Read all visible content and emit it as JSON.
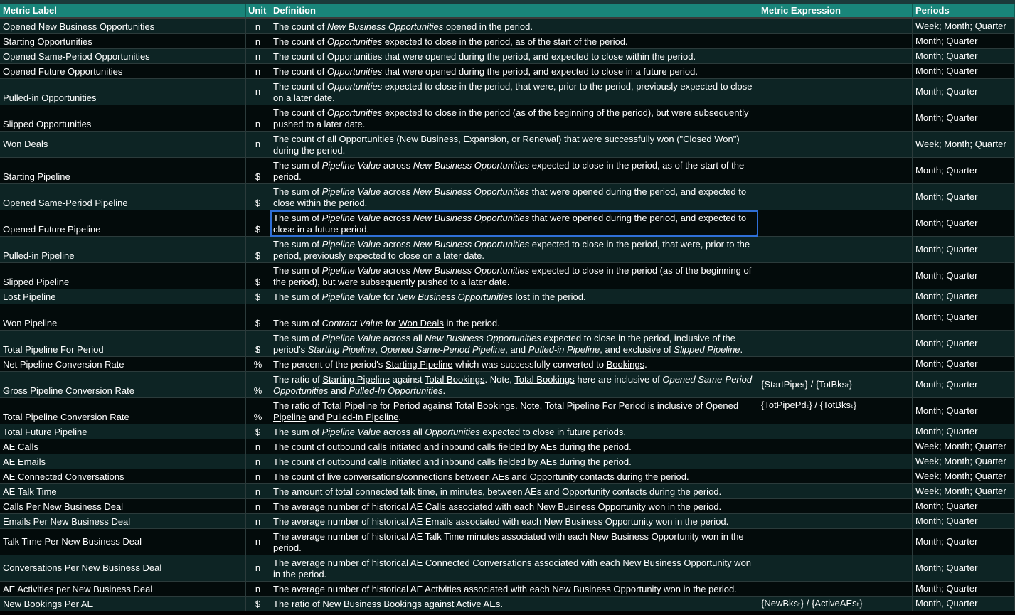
{
  "headers": {
    "label": "Metric Label",
    "unit": "Unit",
    "definition": "Definition",
    "expression": "Metric Expression",
    "periods": "Periods"
  },
  "rows": [
    {
      "label": "Opened New Business Opportunities",
      "unit": "n",
      "def": [
        {
          "t": "The count of "
        },
        {
          "t": "New Business Opportunities",
          "i": 1
        },
        {
          "t": " opened in the period."
        }
      ],
      "expr": "",
      "periods": "Week; Month; Quarter",
      "h": 1
    },
    {
      "label": "Starting Opportunities",
      "unit": "n",
      "def": [
        {
          "t": "The count of "
        },
        {
          "t": "Opportunities",
          "i": 1
        },
        {
          "t": " expected to close in the period, as of the start of the period."
        }
      ],
      "expr": "",
      "periods": "Month; Quarter",
      "h": 1
    },
    {
      "label": "Opened Same-Period Opportunities",
      "unit": "n",
      "def": [
        {
          "t": "The count of Opportunities that were opened during the period, and expected to close within the period."
        }
      ],
      "expr": "",
      "periods": "Month; Quarter",
      "h": 1
    },
    {
      "label": "Opened Future Opportunities",
      "unit": "n",
      "def": [
        {
          "t": "The count of "
        },
        {
          "t": "Opportunities",
          "i": 1
        },
        {
          "t": " that were opened during the period, and expected to close in a future period."
        }
      ],
      "expr": "",
      "periods": "Month; Quarter",
      "h": 1
    },
    {
      "label": "Pulled-in Opportunities",
      "unit": "n",
      "def": [
        {
          "t": "The count of "
        },
        {
          "t": "Opportunities",
          "i": 1
        },
        {
          "t": " expected to close in the period, that were, prior to the period, previously expected to close on a later date."
        }
      ],
      "expr": "",
      "periods": "Month; Quarter",
      "h": 2,
      "unitMid": 1
    },
    {
      "label": "Slipped Opportunities",
      "unit": "n",
      "def": [
        {
          "t": "The count of "
        },
        {
          "t": "Opportunities",
          "i": 1
        },
        {
          "t": " expected to close in the period (as of the beginning of the period), but were subsequently pushed to a later date."
        }
      ],
      "expr": "",
      "periods": "Month; Quarter",
      "h": 2
    },
    {
      "label": "Won Deals",
      "unit": "n",
      "def": [
        {
          "t": "The count of all Opportunities (New Business, Expansion, or Renewal) that were successfully won (\"Closed Won\") during the period."
        }
      ],
      "expr": "",
      "periods": "Week; Month; Quarter",
      "h": 2,
      "labelMid": 1,
      "unitMid": 1
    },
    {
      "label": "Starting Pipeline",
      "unit": "$",
      "def": [
        {
          "t": "The sum of "
        },
        {
          "t": "Pipeline Value",
          "i": 1
        },
        {
          "t": " across "
        },
        {
          "t": "New Business Opportunities",
          "i": 1
        },
        {
          "t": " expected to close in the period, as of the start of the period."
        }
      ],
      "expr": "",
      "periods": "Month; Quarter",
      "h": 2
    },
    {
      "label": "Opened Same-Period Pipeline",
      "unit": "$",
      "def": [
        {
          "t": "The sum of "
        },
        {
          "t": "Pipeline Value",
          "i": 1
        },
        {
          "t": " across "
        },
        {
          "t": "New Business Opportunities",
          "i": 1
        },
        {
          "t": " that were opened during the period, and expected to close within the period."
        }
      ],
      "expr": "",
      "periods": "Month; Quarter",
      "h": 2
    },
    {
      "label": "Opened Future Pipeline",
      "unit": "$",
      "def": [
        {
          "t": "The sum of "
        },
        {
          "t": "Pipeline Value",
          "i": 1
        },
        {
          "t": " across "
        },
        {
          "t": "New Business Opportunities",
          "i": 1
        },
        {
          "t": " that were opened during the period, and expected to close in a future period."
        }
      ],
      "expr": "",
      "periods": "Month; Quarter",
      "h": 2,
      "selected": 1
    },
    {
      "label": "Pulled-in Pipeline",
      "unit": "$",
      "def": [
        {
          "t": "The sum of "
        },
        {
          "t": "Pipeline Value",
          "i": 1
        },
        {
          "t": " across "
        },
        {
          "t": "New Business Opportunities",
          "i": 1
        },
        {
          "t": " expected to close in the period, that were, prior to the period, previously expected to close on a later date."
        }
      ],
      "expr": "",
      "periods": "Month; Quarter",
      "h": 2
    },
    {
      "label": "Slipped Pipeline",
      "unit": "$",
      "def": [
        {
          "t": "The sum of "
        },
        {
          "t": "Pipeline Value",
          "i": 1
        },
        {
          "t": " across "
        },
        {
          "t": "New Business Opportunities",
          "i": 1
        },
        {
          "t": " expected to close in the period (as of the beginning of the period), but were subsequently pushed to a later date."
        }
      ],
      "expr": "",
      "periods": "Month; Quarter",
      "h": 2
    },
    {
      "label": "Lost Pipeline",
      "unit": "$",
      "def": [
        {
          "t": "The sum of "
        },
        {
          "t": "Pipeline Value",
          "i": 1
        },
        {
          "t": " for "
        },
        {
          "t": "New Business Opportunities",
          "i": 1
        },
        {
          "t": " lost in the period."
        }
      ],
      "expr": "",
      "periods": "Month; Quarter",
      "h": 1
    },
    {
      "label": "Won Pipeline",
      "unit": "$",
      "def": [
        {
          "t": "The sum of "
        },
        {
          "t": "Contract Value",
          "i": 1
        },
        {
          "t": " for "
        },
        {
          "t": "Won Deals",
          "u": 1
        },
        {
          "t": " in the period."
        }
      ],
      "expr": "",
      "periods": "Month; Quarter",
      "h": 2
    },
    {
      "label": "Total Pipeline For Period",
      "unit": "$",
      "def": [
        {
          "t": "The sum of "
        },
        {
          "t": "Pipeline Value",
          "i": 1
        },
        {
          "t": " across all "
        },
        {
          "t": "New Business Opportunities",
          "i": 1
        },
        {
          "t": " expected to close in the period, inclusive of the period's "
        },
        {
          "t": "Starting Pipeline",
          "i": 1
        },
        {
          "t": ", "
        },
        {
          "t": "Opened Same-Period Pipeline",
          "i": 1
        },
        {
          "t": ", and "
        },
        {
          "t": "Pulled-in Pipeline",
          "i": 1
        },
        {
          "t": ", and exclusive of "
        },
        {
          "t": "Slipped Pipeline",
          "i": 1
        },
        {
          "t": "."
        }
      ],
      "expr": "",
      "periods": "Month; Quarter",
      "h": 2
    },
    {
      "label": "Net Pipeline Conversion Rate",
      "unit": "%",
      "def": [
        {
          "t": "The percent of the period's "
        },
        {
          "t": "Starting Pipeline",
          "u": 1
        },
        {
          "t": " which was successfully converted to "
        },
        {
          "t": "Bookings",
          "u": 1
        },
        {
          "t": "."
        }
      ],
      "expr": "",
      "periods": "Month; Quarter",
      "h": 1
    },
    {
      "label": "Gross Pipeline Conversion Rate",
      "unit": "%",
      "def": [
        {
          "t": "The ratio of "
        },
        {
          "t": "Starting Pipeline",
          "u": 1
        },
        {
          "t": " against "
        },
        {
          "t": "Total Bookings",
          "u": 1
        },
        {
          "t": ". Note, "
        },
        {
          "t": "Total Bookings",
          "u": 1
        },
        {
          "t": " here are inclusive of "
        },
        {
          "t": "Opened Same-Period Opportunities",
          "i": 1
        },
        {
          "t": " and "
        },
        {
          "t": "Pulled-In Opportunities",
          "i": 1
        },
        {
          "t": "."
        }
      ],
      "expr": "{StartPipeₜ} / {TotBksₜ}",
      "periods": "Month; Quarter",
      "h": 2
    },
    {
      "label": "Total Pipeline Conversion Rate",
      "unit": "%",
      "def": [
        {
          "t": "The ratio of "
        },
        {
          "t": "Total Pipeline for Period",
          "u": 1
        },
        {
          "t": " against "
        },
        {
          "t": "Total Bookings",
          "u": 1
        },
        {
          "t": ". Note, "
        },
        {
          "t": "Total Pipeline For Period",
          "u": 1
        },
        {
          "t": " is inclusive of "
        },
        {
          "t": "Opened Pipeline",
          "u": 1
        },
        {
          "t": " and "
        },
        {
          "t": "Pulled-In Pipeline",
          "u": 1
        },
        {
          "t": "."
        }
      ],
      "expr": "{TotPipePdₜ} / {TotBksₜ}",
      "periods": "Month; Quarter",
      "h": 2,
      "exprTop": 1
    },
    {
      "label": "Total Future Pipeline",
      "unit": "$",
      "def": [
        {
          "t": "The sum of "
        },
        {
          "t": "Pipeline Value",
          "i": 1
        },
        {
          "t": " across all "
        },
        {
          "t": "Opportunities",
          "i": 1
        },
        {
          "t": " expected to close in future periods."
        }
      ],
      "expr": "",
      "periods": "Month; Quarter",
      "h": 1
    },
    {
      "label": "AE Calls",
      "unit": "n",
      "def": [
        {
          "t": "The count of outbound calls initiated and inbound calls fielded by AEs during the period."
        }
      ],
      "expr": "",
      "periods": "Week; Month; Quarter",
      "h": 1
    },
    {
      "label": "AE Emails",
      "unit": "n",
      "def": [
        {
          "t": "The count of outbound calls initiated and inbound calls fielded by AEs during the period."
        }
      ],
      "expr": "",
      "periods": "Week; Month; Quarter",
      "h": 1
    },
    {
      "label": "AE Connected Conversations",
      "unit": "n",
      "def": [
        {
          "t": "The count of live conversations/connections between AEs and Opportunity contacts during the period."
        }
      ],
      "expr": "",
      "periods": "Week; Month; Quarter",
      "h": 1
    },
    {
      "label": "AE Talk Time",
      "unit": "n",
      "def": [
        {
          "t": "The amount of total connected talk time, in minutes, between AEs and Opportunity contacts during the period."
        }
      ],
      "expr": "",
      "periods": "Week; Month; Quarter",
      "h": 1
    },
    {
      "label": "Calls Per New Business Deal",
      "unit": "n",
      "def": [
        {
          "t": "The average number of historical AE Calls associated with each New Business Opportunity won in the period."
        }
      ],
      "expr": "",
      "periods": "Month; Quarter",
      "h": 1
    },
    {
      "label": "Emails Per New Business Deal",
      "unit": "n",
      "def": [
        {
          "t": "The average number of historical AE Emails associated with each New Business Opportunity won in the period."
        }
      ],
      "expr": "",
      "periods": "Month; Quarter",
      "h": 1
    },
    {
      "label": "Talk Time Per New Business Deal",
      "unit": "n",
      "def": [
        {
          "t": "The average number of historical AE Talk Time minutes associated with each New Business Opportunity won in the period."
        }
      ],
      "expr": "",
      "periods": "Month; Quarter",
      "h": 2,
      "labelMid": 1,
      "unitMid": 1
    },
    {
      "label": "Conversations Per New Business Deal",
      "unit": "n",
      "def": [
        {
          "t": "The average number of historical AE Connected Conversations associated with each New Business Opportunity won in the period."
        }
      ],
      "expr": "",
      "periods": "Month; Quarter",
      "h": 2,
      "labelMid": 1,
      "unitMid": 1
    },
    {
      "label": "AE Activities per New Business Deal",
      "unit": "n",
      "def": [
        {
          "t": "The average number of historical AE Activities associated with each New Business Opportunity won in the period."
        }
      ],
      "expr": "",
      "periods": "Month; Quarter",
      "h": 1
    },
    {
      "label": "New Bookings Per AE",
      "unit": "$",
      "def": [
        {
          "t": "The ratio of New Business Bookings against Active AEs."
        }
      ],
      "expr": "{NewBksₜ} / {ActiveAEsₜ}",
      "periods": "Month, Quarter",
      "h": 1
    }
  ]
}
